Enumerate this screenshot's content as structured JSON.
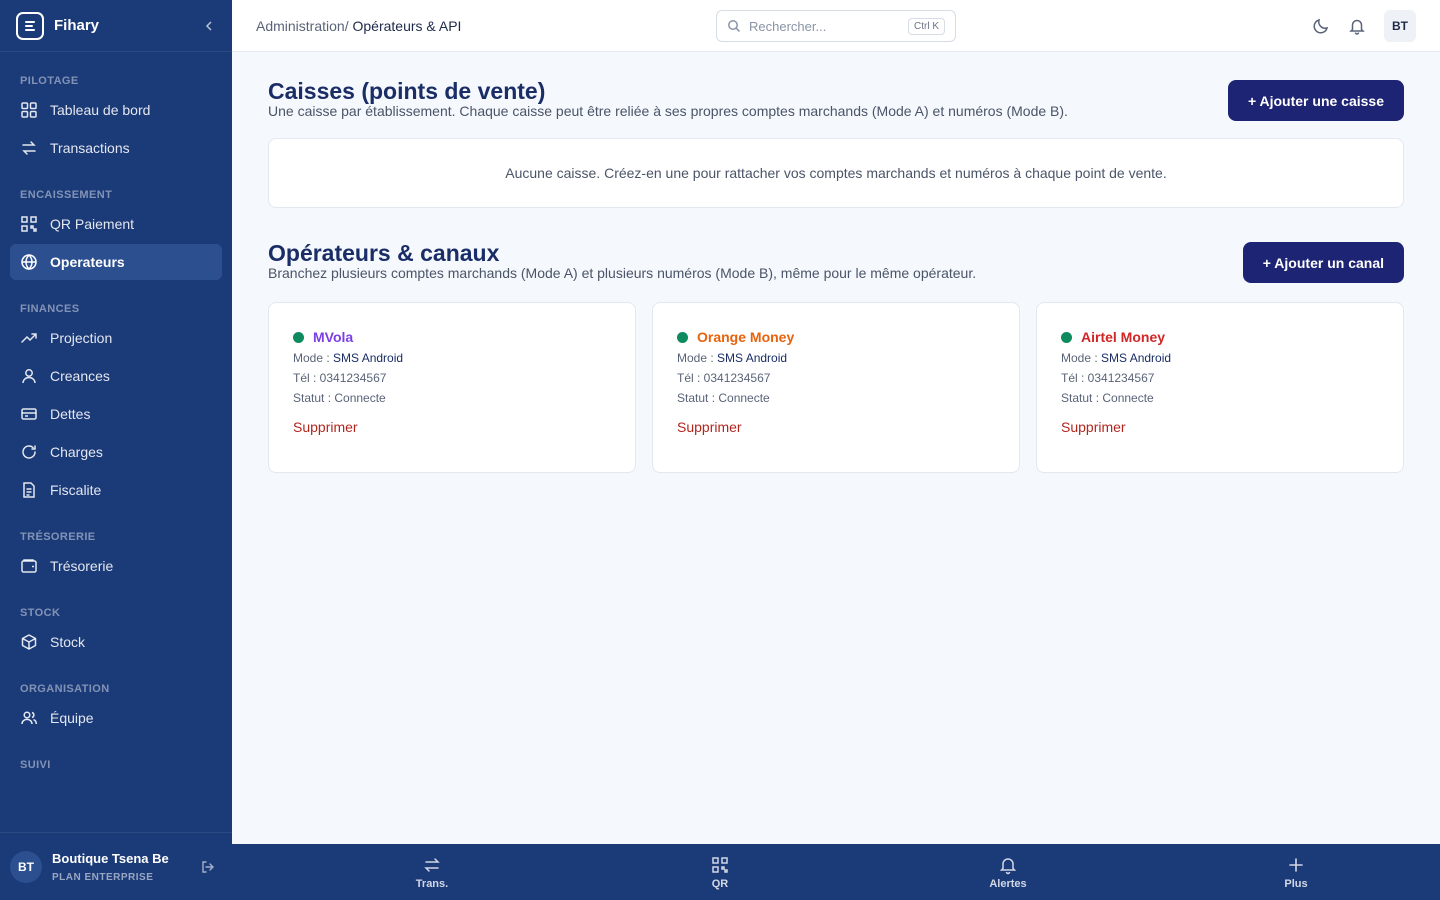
{
  "brand": {
    "name": "Fihary"
  },
  "sidebar": {
    "sections": {
      "pilotage": "PILOTAGE",
      "encaissement": "ENCAISSEMENT",
      "finances": "FINANCES",
      "tresorerie": "TRÉSORERIE",
      "stock": "STOCK",
      "organisation": "ORGANISATION",
      "suivi": "SUIVI"
    },
    "items": {
      "dashboard": "Tableau de bord",
      "transactions": "Transactions",
      "qr": "QR Paiement",
      "operateurs": "Operateurs",
      "projection": "Projection",
      "creances": "Creances",
      "dettes": "Dettes",
      "charges": "Charges",
      "fiscalite": "Fiscalite",
      "tresorerie": "Trésorerie",
      "stock": "Stock",
      "equipe": "Équipe"
    },
    "active": "operateurs"
  },
  "profile": {
    "initials": "BT",
    "name": "Boutique Tsena Be",
    "plan": "PLAN ENTERPRISE"
  },
  "header": {
    "crumb_parent": "Administration/",
    "crumb_current": "Opérateurs & API",
    "search_placeholder": "Rechercher...",
    "search_shortcut": "Ctrl K",
    "avatar": "BT"
  },
  "caisses": {
    "title": "Caisses (points de vente)",
    "description": "Une caisse par établissement. Chaque caisse peut être reliée à ses propres comptes marchands (Mode A) et numéros (Mode B).",
    "button": "+ Ajouter une caisse",
    "empty": "Aucune caisse. Créez-en une pour rattacher vos comptes marchands et numéros à chaque point de vente."
  },
  "operateurs": {
    "title": "Opérateurs & canaux",
    "description": "Branchez plusieurs comptes marchands (Mode A) et plusieurs numéros (Mode B), même pour le même opérateur.",
    "button": "+ Ajouter un canal",
    "labels": {
      "mode": "Mode : ",
      "tel": "Tél : ",
      "statut": "Statut : ",
      "delete": "Supprimer"
    },
    "cards": [
      {
        "name": "MVola",
        "color": "#7b3fe4",
        "mode": "SMS Android",
        "tel": "0341234567",
        "statut": "Connecte"
      },
      {
        "name": "Orange Money",
        "color": "#e8620c",
        "mode": "SMS Android",
        "tel": "0341234567",
        "statut": "Connecte"
      },
      {
        "name": "Airtel Money",
        "color": "#d02626",
        "mode": "SMS Android",
        "tel": "0341234567",
        "statut": "Connecte"
      }
    ],
    "status_color": "#0d8a5e"
  },
  "bottombar": {
    "trans": "Trans.",
    "qr": "QR",
    "alertes": "Alertes",
    "plus": "Plus"
  }
}
